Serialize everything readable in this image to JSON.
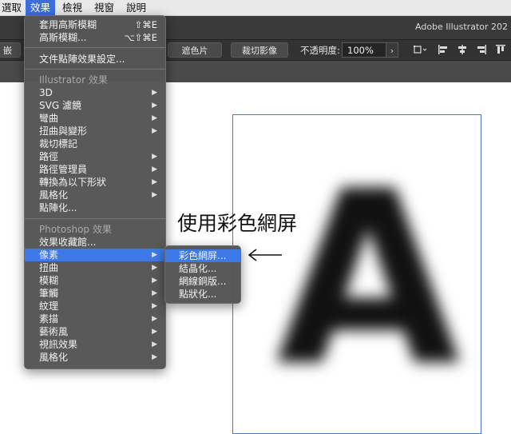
{
  "menubar": {
    "items": [
      {
        "label": "選取"
      },
      {
        "label": "效果"
      },
      {
        "label": "檢視"
      },
      {
        "label": "視窗"
      },
      {
        "label": "說明"
      }
    ],
    "active_index": 1
  },
  "app": {
    "title": "Adobe Illustrator 202"
  },
  "controlbar": {
    "left_cut_label": "嵌入",
    "btn_trace": "遮色片",
    "btn_crop": "裁切影像",
    "opacity_label": "不透明度:",
    "opacity_value": "100%",
    "opacity_arrow": "›"
  },
  "effect_menu": {
    "apply_last": {
      "label": "套用高斯模糊",
      "shortcut": "⇧⌘E"
    },
    "last_effect": {
      "label": "高斯模糊...",
      "shortcut": "⌥⇧⌘E"
    },
    "doc_raster": {
      "label": "文件點陣效果設定..."
    },
    "illustrator_header": "Illustrator 效果",
    "illustrator_items": [
      {
        "label": "3D",
        "submenu": true
      },
      {
        "label": "SVG 濾鏡",
        "submenu": true
      },
      {
        "label": "彎曲",
        "submenu": true
      },
      {
        "label": "扭曲與變形",
        "submenu": true
      },
      {
        "label": "裁切標記",
        "submenu": false
      },
      {
        "label": "路徑",
        "submenu": true
      },
      {
        "label": "路徑管理員",
        "submenu": true
      },
      {
        "label": "轉換為以下形狀",
        "submenu": true
      },
      {
        "label": "風格化",
        "submenu": true
      },
      {
        "label": "點陣化...",
        "submenu": false
      }
    ],
    "photoshop_header": "Photoshop 效果",
    "photoshop_items": [
      {
        "label": "效果收藏館...",
        "submenu": false
      },
      {
        "label": "像素",
        "submenu": true,
        "highlighted": true
      },
      {
        "label": "扭曲",
        "submenu": true
      },
      {
        "label": "模糊",
        "submenu": true
      },
      {
        "label": "筆觸",
        "submenu": true
      },
      {
        "label": "紋理",
        "submenu": true
      },
      {
        "label": "素描",
        "submenu": true
      },
      {
        "label": "藝術風",
        "submenu": true
      },
      {
        "label": "視訊效果",
        "submenu": true
      },
      {
        "label": "風格化",
        "submenu": true
      }
    ],
    "submenu_glyph": "▶"
  },
  "pixelate_submenu": {
    "items": [
      {
        "label": "彩色網屏...",
        "highlighted": true
      },
      {
        "label": "結晶化..."
      },
      {
        "label": "網線銅版..."
      },
      {
        "label": "點狀化..."
      }
    ]
  },
  "annotation": {
    "text": "使用彩色網屏"
  },
  "canvas": {
    "glyph": "A"
  },
  "colors": {
    "highlight": "#3d7ae8",
    "menu_bg": "#565656",
    "artboard_border": "#4a78c8"
  }
}
